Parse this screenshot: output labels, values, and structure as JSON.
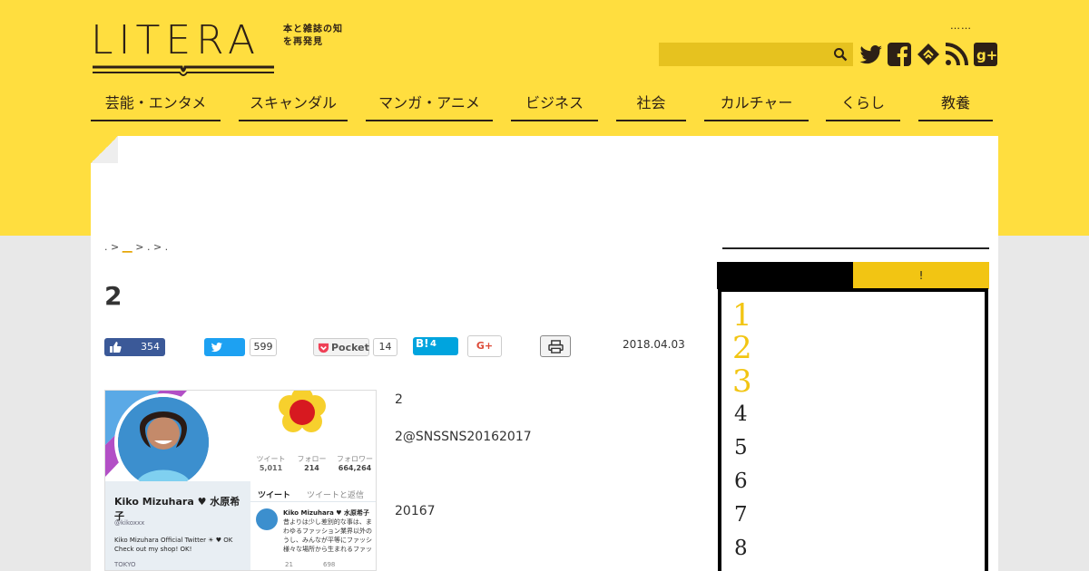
{
  "brand": {
    "logo_text": "LITERA",
    "tagline": "本と雑誌の知を再発見",
    "top_dots": "……"
  },
  "search": {
    "placeholder": "",
    "value": ""
  },
  "social_icons": [
    "twitter-icon",
    "facebook-icon",
    "feedly-icon",
    "rss-icon",
    "googleplus-icon"
  ],
  "nav": {
    "items": [
      "芸能・エンタメ",
      "スキャンダル",
      "マンガ・アニメ",
      "ビジネス",
      "社会",
      "カルチャー",
      "くらし",
      "教養"
    ]
  },
  "breadcrumb": {
    "p1": ".",
    "sep1": ">",
    "link": "__",
    "sep2": ">",
    "p2": ".",
    "sep3": ">",
    "p3": "."
  },
  "article": {
    "title": "2",
    "date": "2018.04.03",
    "paragraphs": [
      "2",
      "2@SNSSNS20162017",
      "20167"
    ]
  },
  "share": {
    "facebook_count": "354",
    "twitter_count": "599",
    "pocket_label": "Pocket",
    "pocket_count": "14",
    "hatena_label": "B!",
    "hatena_count": "4",
    "gplus_label": "G+"
  },
  "profile_image": {
    "name": "Kiko Mizuhara ♥ 水原希子",
    "handle": "@kikoxxx",
    "bio": "Kiko Mizuhara Official Twitter ☀ ♥ OK Check out my shop! OK!",
    "location": "TOKYO",
    "stats": [
      {
        "label": "ツイート",
        "value": "5,011"
      },
      {
        "label": "フォロー",
        "value": "214"
      },
      {
        "label": "フォロワー",
        "value": "664,264"
      }
    ],
    "tabs": [
      "ツイート",
      "ツイートと返信"
    ],
    "tweet_name": "Kiko Mizuhara ♥ 水原希子",
    "tweet_text": "昔よりは少し差別的な事は、ま わゆるファッション業界以外の うし、みんなが平等にファッシ 様々な場所から生まれるファッ",
    "tweet_actions": {
      "replies": "21",
      "retweets": "698"
    }
  },
  "ranking": {
    "tab_a": "",
    "tab_b": "!",
    "numbers": [
      "1",
      "2",
      "3",
      "4",
      "5",
      "6",
      "7",
      "8"
    ]
  },
  "colors": {
    "brand_yellow": "#ffde3f",
    "search_bg": "#e6c21f",
    "rank_gold": "#f2c513",
    "ink": "#2d2016"
  }
}
